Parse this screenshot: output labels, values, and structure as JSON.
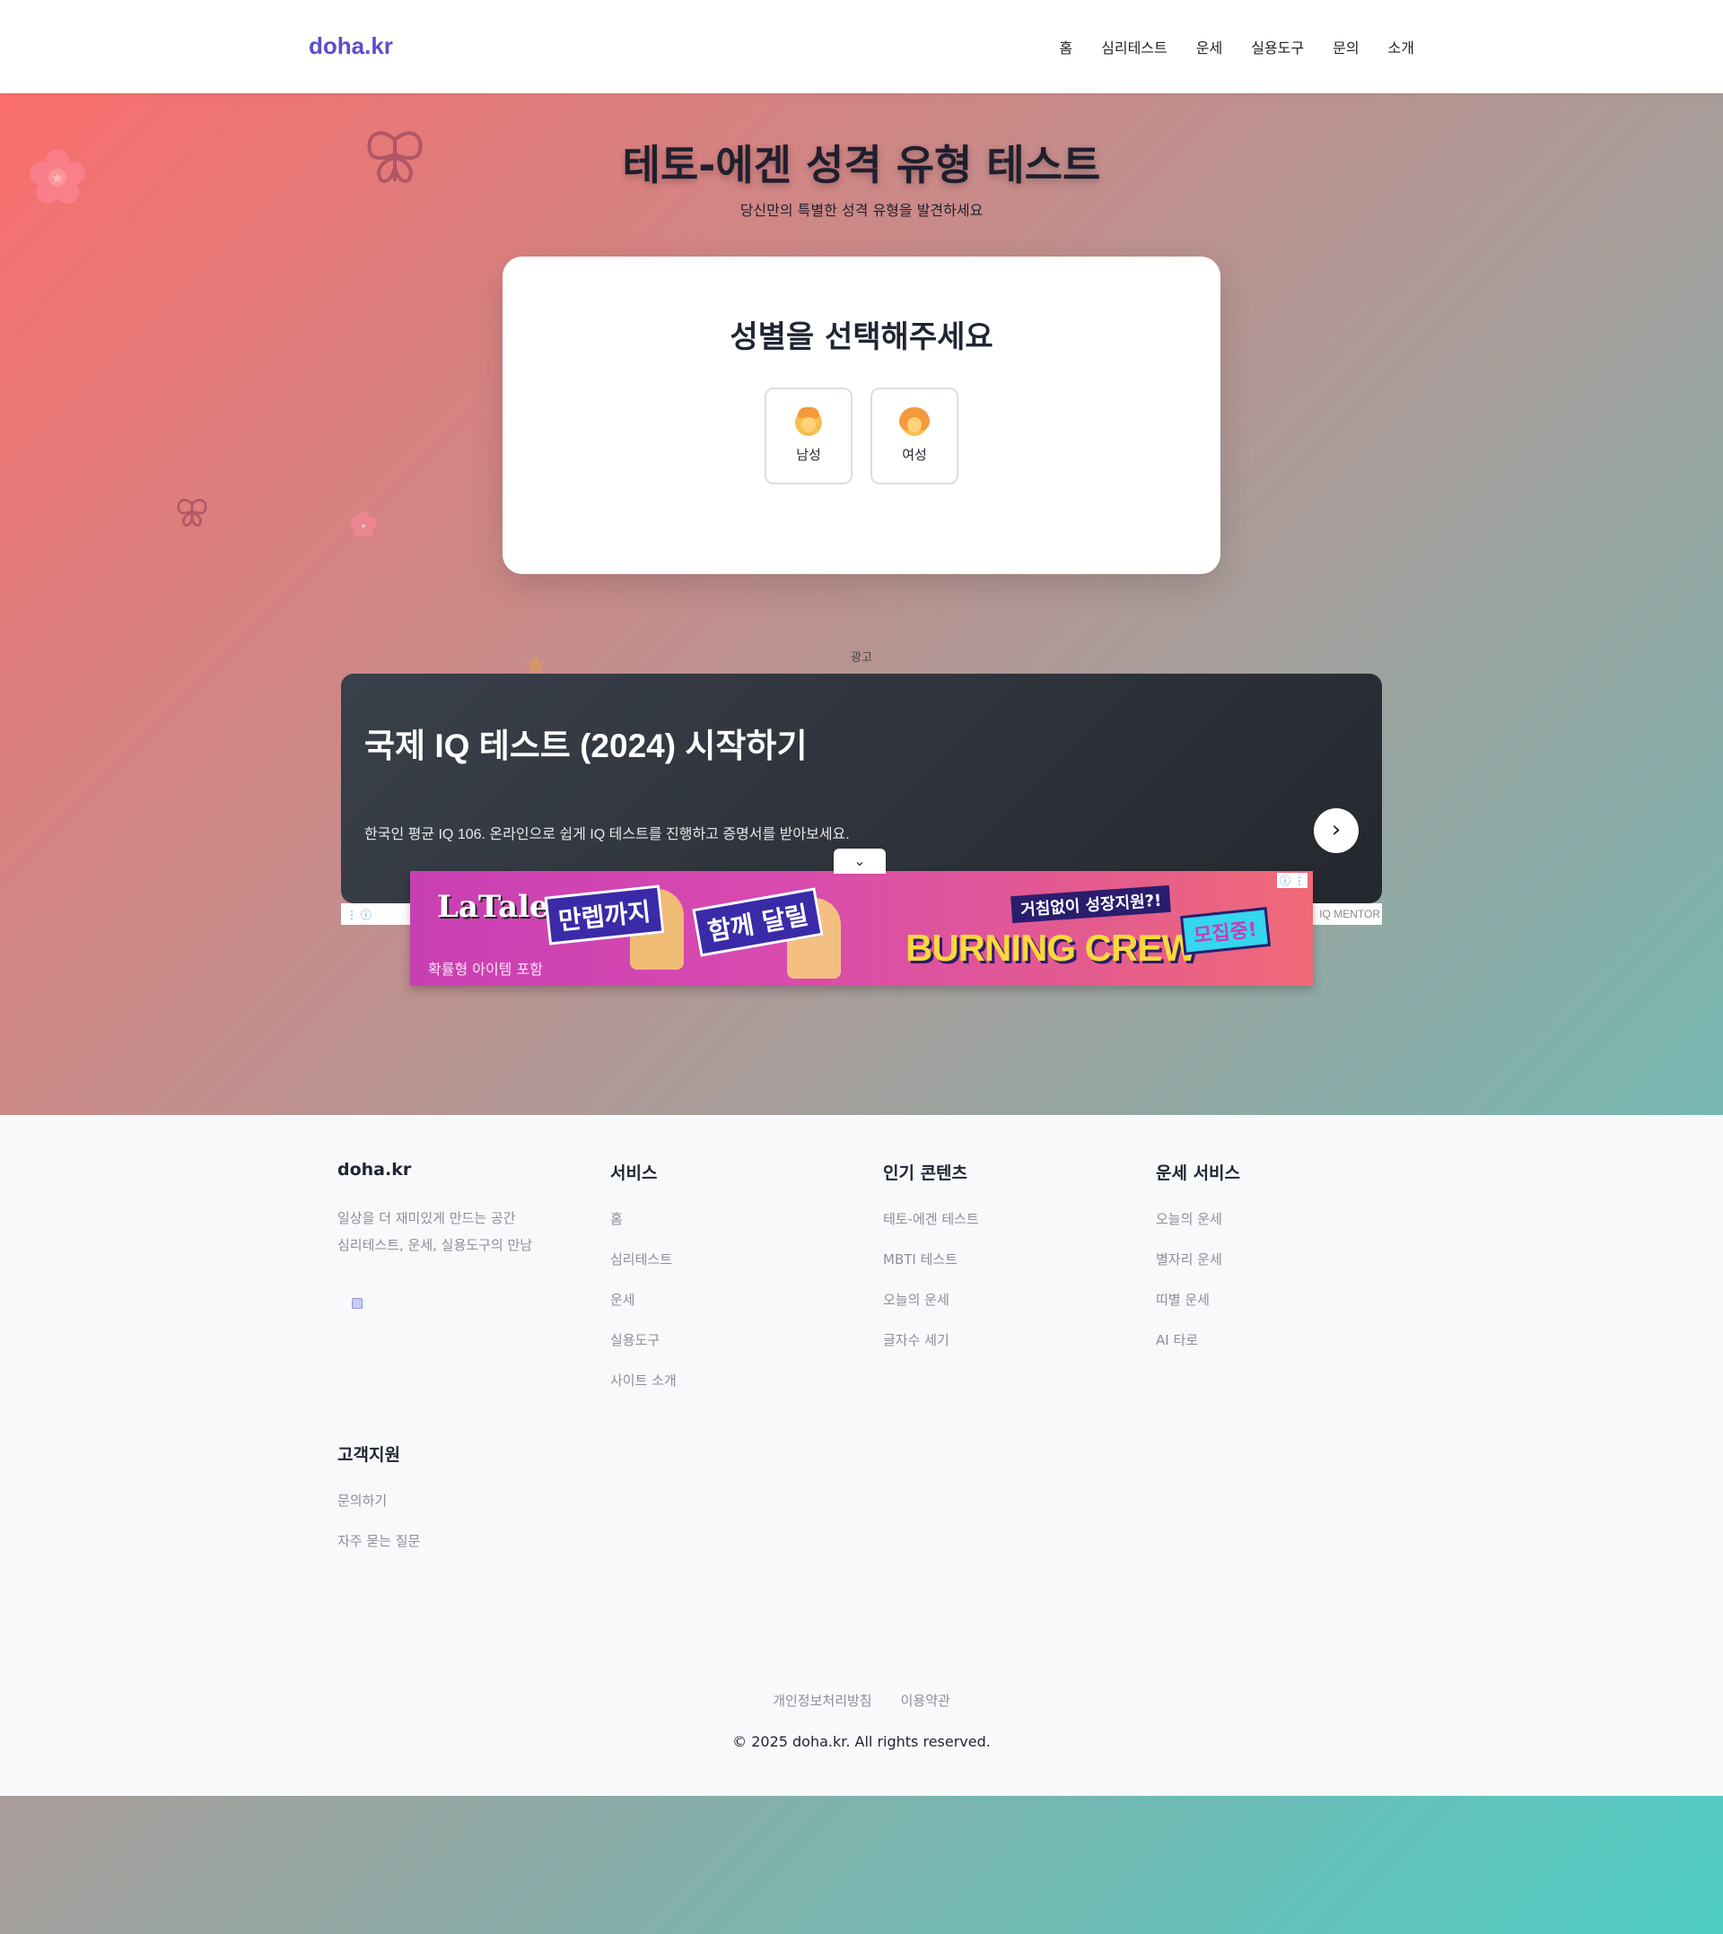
{
  "header": {
    "logo": "doha.kr",
    "nav": [
      "홈",
      "심리테스트",
      "운세",
      "실용도구",
      "문의",
      "소개"
    ]
  },
  "hero": {
    "title": "테토-에겐 성격 유형 테스트",
    "subtitle": "당신만의 특별한 성격 유형을 발견하세요"
  },
  "card": {
    "heading": "성별을 선택해주세요",
    "options": [
      {
        "label": "남성",
        "icon": "man-face-icon"
      },
      {
        "label": "여성",
        "icon": "woman-face-icon"
      }
    ]
  },
  "ad": {
    "label": "광고",
    "primary": {
      "title": "국제 IQ 테스트 (2024) 시작하기",
      "description": "한국인 평균 IQ 106. 온라인으로 쉽게 IQ 테스트를 진행하고 증명서를 받아보세요.",
      "brand": "IQ MENTOR"
    },
    "secondary": {
      "logo": "LaTale",
      "item_text": "확률형 아이템 포함",
      "banner1": "만렙까지",
      "banner2": "함께 달릴",
      "growth": "거침없이 성장지원?!",
      "headline": "BURNING CREW",
      "recruit": "모집중!"
    }
  },
  "footer": {
    "about": {
      "title": "doha.kr",
      "tagline_line1": "일상을 더 재미있게 만드는 공간",
      "tagline_line2": "심리테스트, 운세, 실용도구의 만남"
    },
    "services": {
      "title": "서비스",
      "links": [
        "홈",
        "심리테스트",
        "운세",
        "실용도구",
        "사이트 소개"
      ]
    },
    "popular": {
      "title": "인기 콘텐츠",
      "links": [
        "테토-에겐 테스트",
        "MBTI 테스트",
        "오늘의 운세",
        "글자수 세기"
      ]
    },
    "fortune": {
      "title": "운세 서비스",
      "links": [
        "오늘의 운세",
        "별자리 운세",
        "띠별 운세",
        "AI 타로"
      ]
    },
    "support": {
      "title": "고객지원",
      "links": [
        "문의하기",
        "자주 묻는 질문"
      ]
    },
    "bottom_links": [
      "개인정보처리방침",
      "이용약관"
    ],
    "copyright": "© 2025 doha.kr. All rights reserved."
  },
  "colors": {
    "brand": "#5a4fcf",
    "gradient_start": "#ff6b6b",
    "gradient_end": "#4ecdc4"
  }
}
